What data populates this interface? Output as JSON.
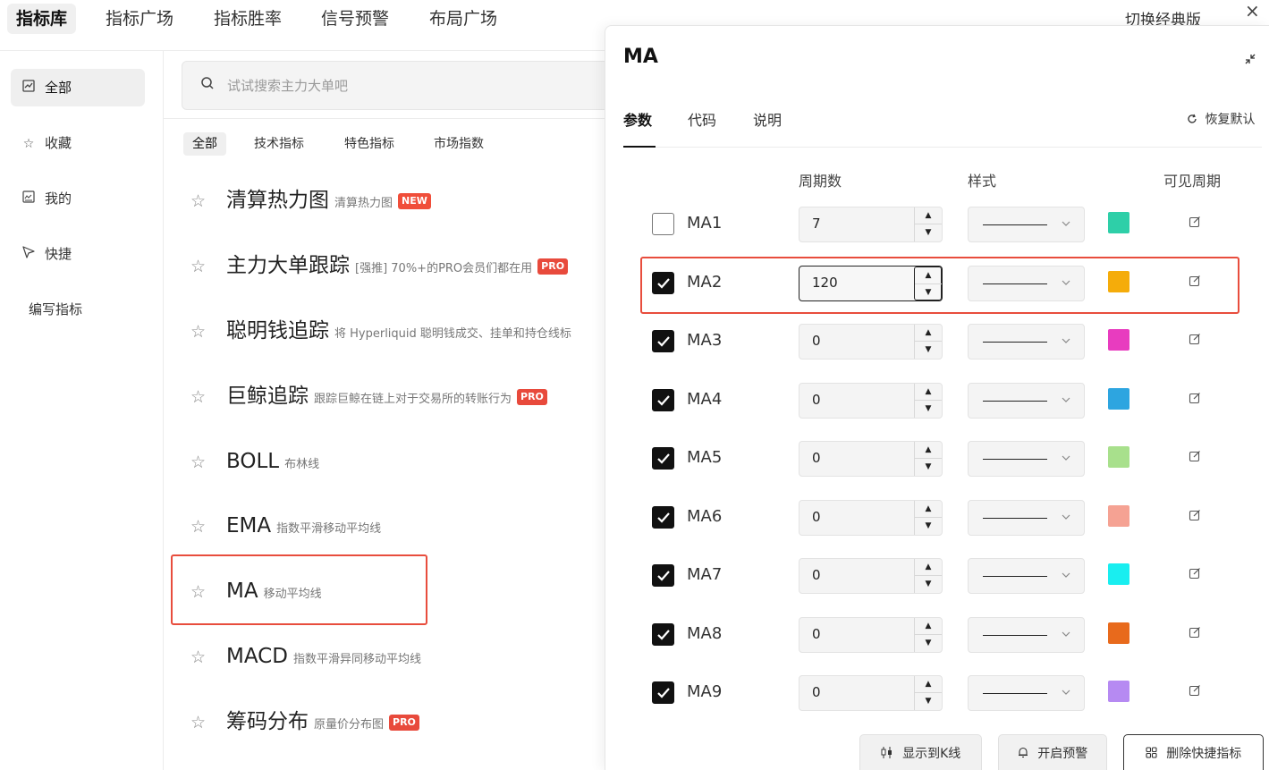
{
  "nav": {
    "tabs": [
      {
        "label": "指标库"
      },
      {
        "label": "指标广场"
      },
      {
        "label": "指标胜率"
      },
      {
        "label": "信号预警"
      },
      {
        "label": "布局广场"
      }
    ],
    "switch_classic": "切换经典版",
    "close_icon": "×"
  },
  "sidebar": {
    "items": [
      {
        "label": "全部",
        "icon": "chart-icon",
        "glyph": "⌇"
      },
      {
        "label": "收藏",
        "icon": "star-icon",
        "glyph": "☆"
      },
      {
        "label": "我的",
        "icon": "user-chart-icon",
        "glyph": "▣"
      },
      {
        "label": "快捷",
        "icon": "send-icon",
        "glyph": "▷"
      }
    ],
    "write": "编写指标"
  },
  "search": {
    "placeholder": "试试搜索主力大单吧"
  },
  "filters": [
    {
      "label": "全部"
    },
    {
      "label": "技术指标"
    },
    {
      "label": "特色指标"
    },
    {
      "label": "市场指数"
    }
  ],
  "indicators": [
    {
      "name": "清算热力图",
      "desc": "清算热力图",
      "badge": "NEW"
    },
    {
      "name": "主力大单跟踪",
      "desc": "[强推] 70%+的PRO会员们都在用",
      "badge": "PRO"
    },
    {
      "name": "聪明钱追踪",
      "desc": "将 Hyperliquid 聪明钱成交、挂单和持仓线标",
      "badge": ""
    },
    {
      "name": "巨鲸追踪",
      "desc": "跟踪巨鲸在链上对于交易所的转账行为",
      "badge": "PRO"
    },
    {
      "name": "BOLL",
      "desc": "布林线",
      "badge": ""
    },
    {
      "name": "EMA",
      "desc": "指数平滑移动平均线",
      "badge": ""
    },
    {
      "name": "MA",
      "desc": "移动平均线",
      "badge": ""
    },
    {
      "name": "MACD",
      "desc": "指数平滑异同移动平均线",
      "badge": ""
    },
    {
      "name": "筹码分布",
      "desc": "原量价分布图",
      "badge": "PRO"
    }
  ],
  "panel": {
    "title": "MA",
    "tabs": [
      {
        "label": "参数"
      },
      {
        "label": "代码"
      },
      {
        "label": "说明"
      }
    ],
    "restore": "恢复默认",
    "columns": {
      "period": "周期数",
      "style": "样式",
      "visible": "可见周期"
    },
    "rows": [
      {
        "label": "MA1",
        "checked": false,
        "period": "7",
        "color": "#2ecfa8"
      },
      {
        "label": "MA2",
        "checked": true,
        "period": "120",
        "color": "#f5ac0a"
      },
      {
        "label": "MA3",
        "checked": true,
        "period": "0",
        "color": "#e83cbf"
      },
      {
        "label": "MA4",
        "checked": true,
        "period": "0",
        "color": "#2da5e0"
      },
      {
        "label": "MA5",
        "checked": true,
        "period": "0",
        "color": "#a8e08c"
      },
      {
        "label": "MA6",
        "checked": true,
        "period": "0",
        "color": "#f5a293"
      },
      {
        "label": "MA7",
        "checked": true,
        "period": "0",
        "color": "#19eef0"
      },
      {
        "label": "MA8",
        "checked": true,
        "period": "0",
        "color": "#e86a1c"
      },
      {
        "label": "MA9",
        "checked": true,
        "period": "0",
        "color": "#b68af2"
      }
    ],
    "buttons": {
      "show_kline": "显示到K线",
      "alert": "开启预警",
      "delete_shortcut": "删除快捷指标"
    }
  }
}
